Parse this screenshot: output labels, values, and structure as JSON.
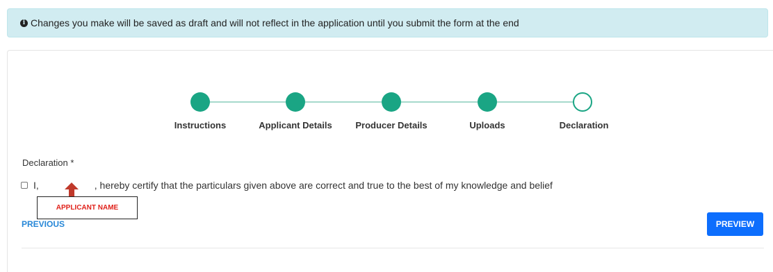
{
  "alert": {
    "icon": "info-circle-icon",
    "icon_glyph": "i",
    "message": "Changes you make will be saved as draft and will not reflect in the application until you submit the form at the end"
  },
  "stepper": {
    "accent_color": "#1aa584",
    "connector_color": "#a5d9cc",
    "steps": [
      {
        "label": "Instructions",
        "status": "complete"
      },
      {
        "label": "Applicant Details",
        "status": "complete"
      },
      {
        "label": "Producer Details",
        "status": "complete"
      },
      {
        "label": "Uploads",
        "status": "complete"
      },
      {
        "label": "Declaration",
        "status": "current"
      }
    ]
  },
  "declaration": {
    "label": "Declaration *",
    "text_prefix": "I,",
    "text_suffix": ", hereby certify that the particulars given above are correct and true to the best of my knowledge and belief",
    "checked": false
  },
  "annotation": {
    "label": "APPLICANT NAME",
    "arrow_color": "#c0392b"
  },
  "actions": {
    "previous_label": "PREVIOUS",
    "preview_label": "PREVIEW",
    "primary_color": "#0d6efd"
  }
}
